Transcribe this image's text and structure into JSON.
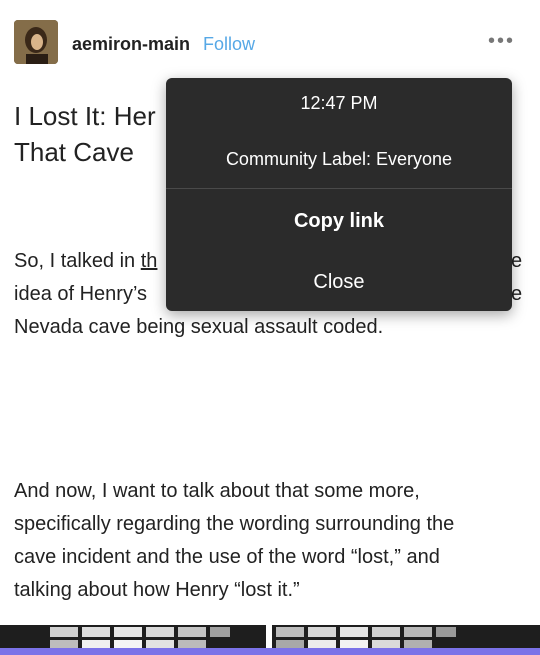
{
  "post": {
    "blog_name": "aemiron-main",
    "follow_label": "Follow",
    "more_label": "•••",
    "title_lines": [
      "I Lost It: Her",
      "That Cave"
    ],
    "paragraph1": {
      "line1_start": "So, I talked in ",
      "link_fragment": "th",
      "line1_end": "e",
      "line2_start": "idea of Henry’s",
      "line2_end": "e",
      "line3": "Nevada cave being sexual assault coded."
    },
    "paragraph2_lines": [
      "And now, I want to talk about that some more,",
      "specifically regarding the wording surrounding the",
      "cave incident and the use of the word “lost,” and",
      "talking about how Henry “lost it.”"
    ]
  },
  "popup": {
    "time": "12:47 PM",
    "community_label": "Community Label: Everyone",
    "copy_link": "Copy link",
    "close": "Close"
  },
  "colors": {
    "follow": "#56a8e6",
    "popup_bg": "#2b2b2b",
    "bottom_bar": "#7b72e8"
  },
  "icons": {
    "avatar": "portrait-avatar",
    "more": "more-horizontal-icon"
  }
}
